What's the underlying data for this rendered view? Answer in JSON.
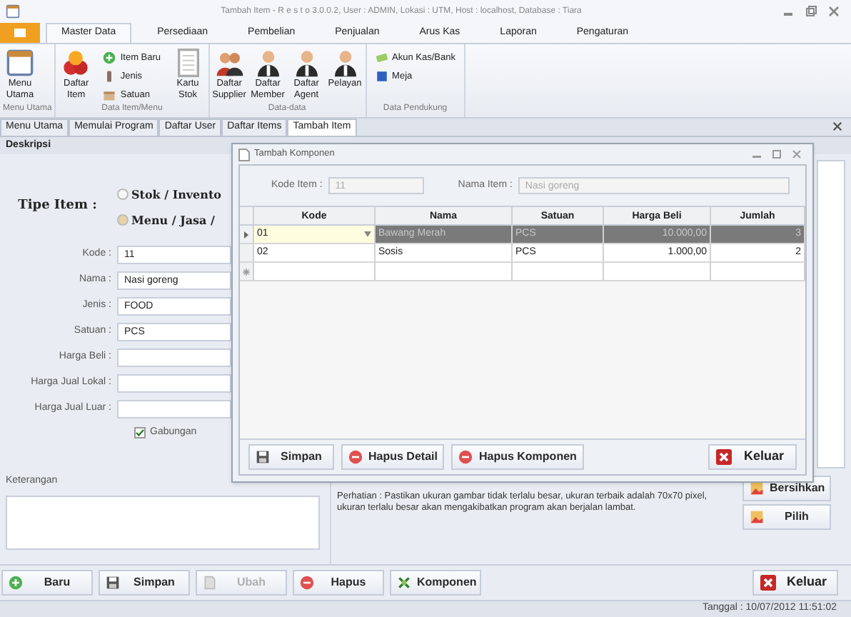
{
  "window": {
    "title": "Tambah Item - R e s t o 3.0.0.2,  User : ADMIN, Lokasi : UTM, Host : localhost, Database : Tiara"
  },
  "ribbon_tabs": [
    {
      "label": "Master Data",
      "selected": true
    },
    {
      "label": "Persediaan",
      "selected": false
    },
    {
      "label": "Pembelian",
      "selected": false
    },
    {
      "label": "Penjualan",
      "selected": false
    },
    {
      "label": "Arus Kas",
      "selected": false
    },
    {
      "label": "Laporan",
      "selected": false
    },
    {
      "label": "Pengaturan",
      "selected": false
    }
  ],
  "ribbon_groups": [
    {
      "label": "Menu Utama",
      "items": [
        {
          "label": "Menu Utama",
          "kind": "large"
        }
      ]
    },
    {
      "label": "Data Item/Menu",
      "items": [
        {
          "label": "Daftar Item",
          "kind": "large"
        },
        {
          "label": "Item Baru",
          "kind": "small"
        },
        {
          "label": "Jenis",
          "kind": "small"
        },
        {
          "label": "Satuan",
          "kind": "small"
        },
        {
          "label": "Kartu Stok",
          "kind": "large"
        }
      ]
    },
    {
      "label": "Data-data",
      "items": [
        {
          "label": "Daftar Supplier",
          "kind": "large"
        },
        {
          "label": "Daftar Member",
          "kind": "large"
        },
        {
          "label": "Daftar Agent",
          "kind": "large"
        },
        {
          "label": "Pelayan",
          "kind": "large"
        }
      ]
    },
    {
      "label": "Data Pendukung",
      "items": [
        {
          "label": "Akun Kas/Bank",
          "kind": "small"
        },
        {
          "label": "Meja",
          "kind": "small"
        }
      ]
    }
  ],
  "doc_tabs": [
    {
      "label": "Menu Utama",
      "selected": false
    },
    {
      "label": "Memulai Program",
      "selected": false
    },
    {
      "label": "Daftar User",
      "selected": false
    },
    {
      "label": "Daftar Items",
      "selected": false
    },
    {
      "label": "Tambah Item",
      "selected": true
    }
  ],
  "section_header": "Deskripsi",
  "tipe_item": {
    "label": "Tipe Item :",
    "options": [
      {
        "label": "Stok / Invento",
        "selected": false
      },
      {
        "label": "Menu / Jasa /",
        "selected": true
      }
    ]
  },
  "fields": [
    {
      "label": "Kode :",
      "value": "11"
    },
    {
      "label": "Nama :",
      "value": "Nasi goreng"
    },
    {
      "label": "Jenis :",
      "value": "FOOD"
    },
    {
      "label": "Satuan :",
      "value": "PCS"
    },
    {
      "label": "Harga Beli :"
    },
    {
      "label": "Harga Jual Lokal :"
    },
    {
      "label": "Harga Jual Luar :"
    }
  ],
  "gabungan": {
    "label": "Gabungan",
    "checked": true
  },
  "keterangan": {
    "label": "Keterangan"
  },
  "note": "Perhatian : Pastikan ukuran gambar tidak terlalu besar, ukuran terbaik adalah 70x70 pixel, ukuran terlalu besar akan mengakibatkan program akan berjalan lambat.",
  "side_buttons": [
    {
      "label": "Bersihkan"
    },
    {
      "label": "Pilih"
    }
  ],
  "bottom_buttons": [
    {
      "label": "Baru",
      "disabled": false
    },
    {
      "label": "Simpan",
      "disabled": false
    },
    {
      "label": "Ubah",
      "disabled": true
    },
    {
      "label": "Hapus",
      "disabled": false
    },
    {
      "label": "Komponen",
      "disabled": false
    }
  ],
  "exit_button": {
    "label": "Keluar"
  },
  "dialog": {
    "title": "Tambah Komponen",
    "kode_item_label": "Kode Item :",
    "kode_item_value": "11",
    "nama_item_label": "Nama Item :",
    "nama_item_value": "Nasi goreng",
    "columns": [
      "Kode",
      "Nama",
      "Satuan",
      "Harga Beli",
      "Jumlah"
    ],
    "rows": [
      {
        "kind": "data",
        "current": true,
        "selected": true,
        "cells": [
          "01",
          "Bawang Merah",
          "PCS",
          "10.000,00",
          "3"
        ]
      },
      {
        "kind": "data",
        "current": false,
        "selected": false,
        "cells": [
          "02",
          "Sosis",
          "PCS",
          "1.000,00",
          "2"
        ]
      },
      {
        "kind": "new",
        "current": false,
        "selected": false,
        "cells": []
      }
    ],
    "buttons": [
      {
        "label": "Simpan"
      },
      {
        "label": "Hapus Detail"
      },
      {
        "label": "Hapus Komponen"
      }
    ],
    "exit_button": {
      "label": "Keluar"
    }
  },
  "status_bar": {
    "text": "Tanggal : 10/07/2012 11:51:02"
  }
}
